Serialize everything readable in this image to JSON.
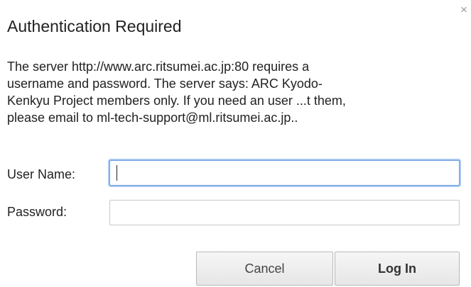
{
  "dialog": {
    "title": "Authentication Required",
    "close_icon": "close-icon",
    "close_glyph": "×",
    "message_lines": [
      "The server http://www.arc.ritsumei.ac.jp:80 requires a",
      "username and password. The server says: ARC Kyodo-",
      "Kenkyu Project members only. If you need an user ...t them,",
      "please email to ml-tech-support@ml.ritsumei.ac.jp.."
    ]
  },
  "form": {
    "username_label": "User Name:",
    "username_value": "",
    "password_label": "Password:",
    "password_value": ""
  },
  "buttons": {
    "cancel_label": "Cancel",
    "login_label": "Log In"
  },
  "colors": {
    "focus_ring": "#6a9fe0",
    "text": "#222222",
    "button_border": "#b8b8b8"
  }
}
